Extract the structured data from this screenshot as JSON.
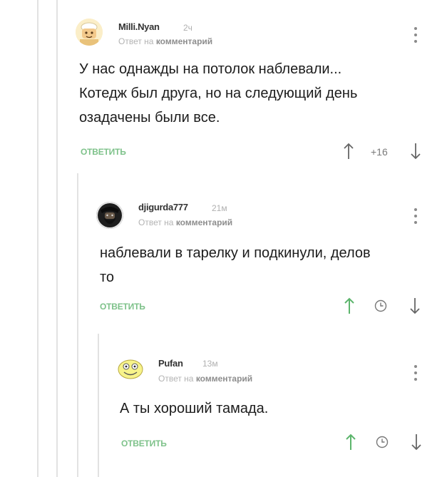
{
  "comments": [
    {
      "author": "Milli.Nyan",
      "time": "2ч",
      "reply_prefix": "Ответ на",
      "reply_target": "комментарий",
      "text_lines": [
        "У нас однажды на потолок наблевали...",
        "Котедж был друга, но на следующий день",
        "озадачены были все."
      ],
      "reply_label": "ОТВЕТИТЬ",
      "rating": "+16",
      "avatar_icon": "avatar-cartoon-cook-icon"
    },
    {
      "author": "djigurda777",
      "time": "21м",
      "reply_prefix": "Ответ на",
      "reply_target": "комментарий",
      "text_lines": [
        "наблевали в тарелку и подкинули, делов",
        "то"
      ],
      "reply_label": "ОТВЕТИТЬ",
      "avatar_icon": "avatar-bearded-man-icon"
    },
    {
      "author": "Pufan",
      "time": "13м",
      "reply_prefix": "Ответ на",
      "reply_target": "комментарий",
      "text_lines": [
        "А ты хороший тамада."
      ],
      "reply_label": "ОТВЕТИТЬ",
      "avatar_icon": "avatar-smiley-icon"
    }
  ],
  "colors": {
    "accent_green": "#7ec28a",
    "thread_line": "#e2e2e2",
    "muted_text": "#b0b0b0"
  }
}
